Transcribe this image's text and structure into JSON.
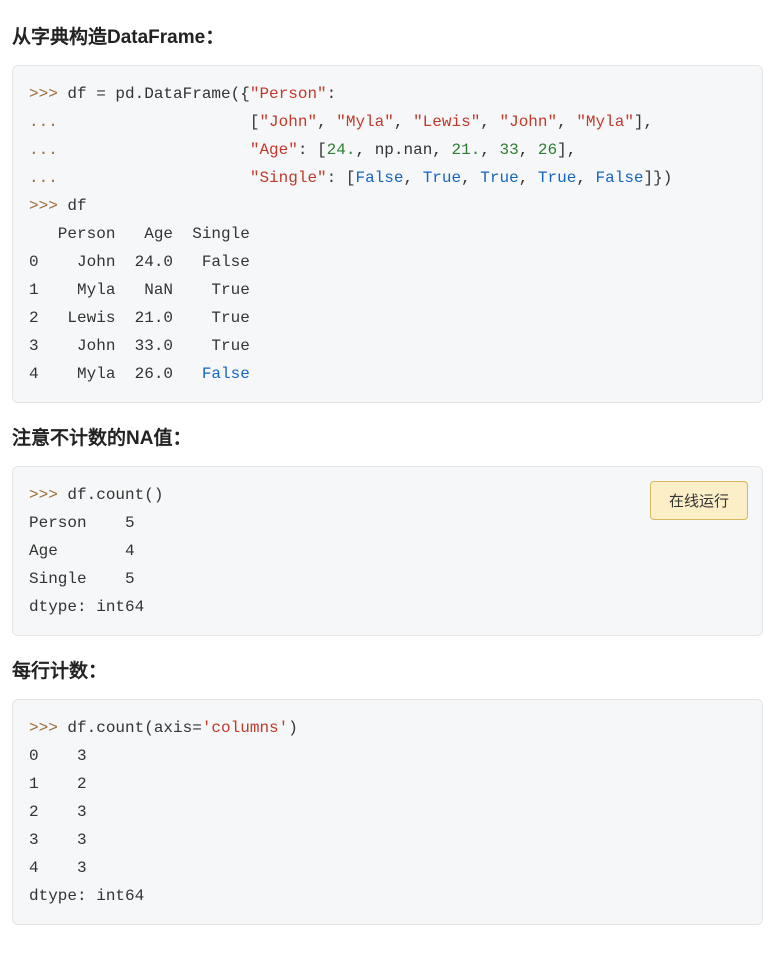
{
  "sections": {
    "s1": {
      "heading": "从字典构造DataFrame："
    },
    "s2": {
      "heading": "注意不计数的NA值："
    },
    "s3": {
      "heading": "每行计数："
    }
  },
  "run_button_label": "在线运行",
  "code1": {
    "prompt": ">>> ",
    "cont": "...                    ",
    "assign": "df = pd.DataFrame({",
    "k_person": "\"Person\"",
    "colon": ":",
    "open_list": "[",
    "p_vals": [
      "\"John\"",
      "\"Myla\"",
      "\"Lewis\"",
      "\"John\"",
      "\"Myla\""
    ],
    "close_list_comma": "],",
    "k_age": "\"Age\"",
    "age_open": ": [",
    "a_24": "24.",
    "np_nan": ", np.nan, ",
    "a_21": "21.",
    "sep": ", ",
    "a_33": "33",
    "a_26": "26",
    "close_bracket_comma": "],",
    "k_single": "\"Single\"",
    "single_open": ": [",
    "s_false": "False",
    "s_true": "True",
    "close_all": "]})",
    "echo_df": "df",
    "output": "   Person   Age  Single\n0    John  24.0   False\n1    Myla   NaN    True\n2   Lewis  21.0    True\n3    John  33.0    True\n4    Myla  26.0   ",
    "last_false": "False"
  },
  "code2": {
    "call": "df.count()",
    "output": "Person    5\nAge       4\nSingle    5\ndtype: int64"
  },
  "code3": {
    "call_pre": "df.count(axis=",
    "axis_arg": "'columns'",
    "call_post": ")",
    "output": "0    3\n1    2\n2    3\n3    3\n4    3\ndtype: int64"
  }
}
